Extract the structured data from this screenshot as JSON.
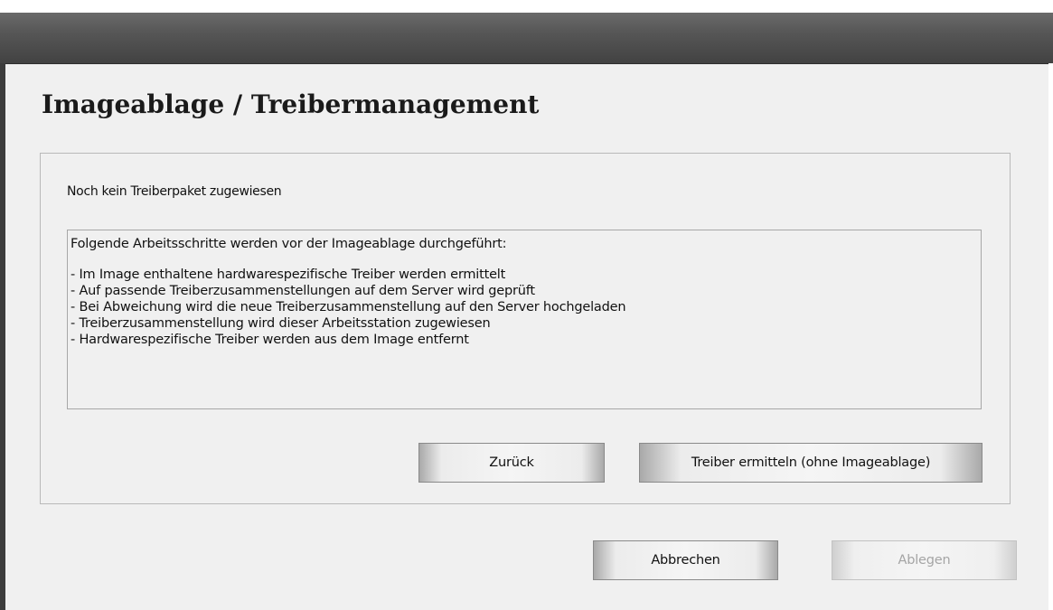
{
  "dialog": {
    "title": "Imageablage / Treibermanagement",
    "status": "Noch kein Treiberpaket zugewiesen",
    "info_heading": "Folgende Arbeitsschritte werden vor der Imageablage durchgeführt:",
    "steps": [
      "- Im Image enthaltene hardwarespezifische Treiber werden ermittelt",
      "- Auf passende Treiberzusammenstellungen auf dem Server wird geprüft",
      "- Bei Abweichung wird die neue Treiberzusammenstellung auf den Server hochgeladen",
      "- Treiberzusammenstellung wird dieser Arbeitsstation zugewiesen",
      "- Hardwarespezifische Treiber werden aus dem Image entfernt"
    ],
    "buttons": {
      "back": "Zurück",
      "detect": "Treiber ermitteln (ohne Imageablage)",
      "cancel": "Abbrechen",
      "store": "Ablegen"
    }
  }
}
